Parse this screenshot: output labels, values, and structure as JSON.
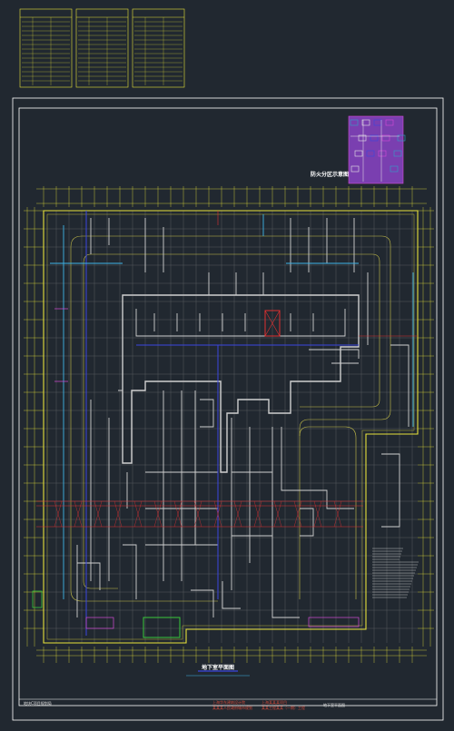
{
  "drawing": {
    "plan_title": "地下室平面图",
    "legend_title": "防火分区示意图",
    "footer": {
      "company": "地块C项目规划局",
      "client_block": "上海华东建筑设计院",
      "client_block_2": "某某某人民政府城市规划",
      "project_block": "上海某某某项目",
      "project_block_2": "某某工程某某（一期）工程",
      "sheet_name": "地下室平面图"
    }
  },
  "colors": {
    "background": "#212830",
    "frame": "#ffffff",
    "wall": "#d0d0d0",
    "outline": "#e8e23a",
    "road": "#c9c24a",
    "axis_blue": "#3a46e0",
    "cyan": "#3fb5e8",
    "red": "#e03030",
    "magenta": "#d44ad8",
    "green": "#39c93a"
  },
  "icons": {
    "legend_map": "fire-zone-mini-map-icon",
    "north_marker": "grid-axis-marker-icon"
  }
}
